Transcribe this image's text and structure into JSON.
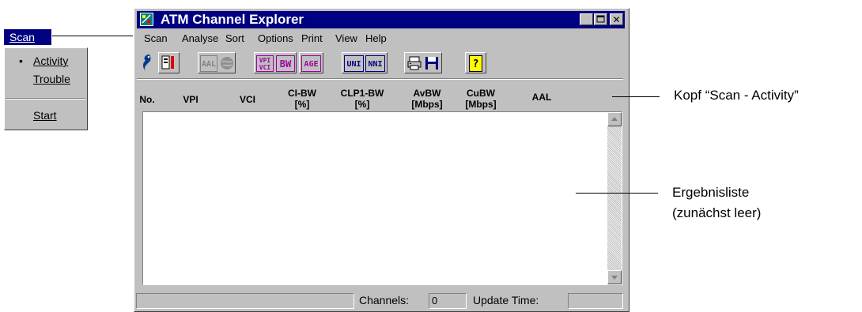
{
  "popup_menu": {
    "title": "Scan",
    "items": [
      "Activity",
      "Trouble",
      "Start"
    ],
    "checked": "Activity"
  },
  "window": {
    "title": "ATM Channel Explorer",
    "menubar": [
      "Scan",
      "Analyse",
      "Sort",
      "Options",
      "Print",
      "View",
      "Help"
    ],
    "toolbar": {
      "aal": "AAL",
      "vpi": "VPI",
      "vci": "VCI",
      "bw": "BW",
      "age": "AGE",
      "uni": "UNI",
      "nni": "NNI",
      "help": "?"
    },
    "columns": [
      {
        "line1": "No.",
        "line2": ""
      },
      {
        "line1": "VPI",
        "line2": ""
      },
      {
        "line1": "VCI",
        "line2": ""
      },
      {
        "line1": "CI-BW",
        "line2": "[%]"
      },
      {
        "line1": "CLP1-BW",
        "line2": "[%]"
      },
      {
        "line1": "AvBW",
        "line2": "[Mbps]"
      },
      {
        "line1": "CuBW",
        "line2": "[Mbps]"
      },
      {
        "line1": "AAL",
        "line2": ""
      }
    ],
    "status": {
      "channels_label": "Channels:",
      "channels_value": "0",
      "update_label": "Update Time:",
      "update_value": ""
    }
  },
  "callouts": {
    "header": "Kopf “Scan - Activity”",
    "list_line1": "Ergebnisliste",
    "list_line2": "(zunächst leer)"
  },
  "colors": {
    "face": "#c0c0c0",
    "titlebar": "#000080",
    "highlight": "#000080"
  }
}
